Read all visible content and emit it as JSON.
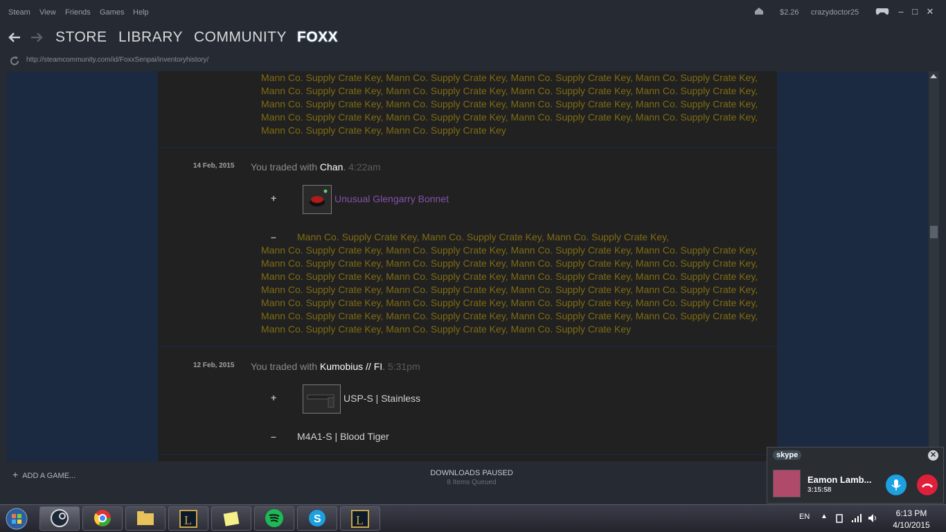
{
  "menu": {
    "items": [
      "Steam",
      "View",
      "Friends",
      "Games",
      "Help"
    ]
  },
  "account": {
    "balance": "$2.26",
    "username": "crazydoctor25"
  },
  "nav": {
    "store": "STORE",
    "library": "LIBRARY",
    "community": "COMMUNITY",
    "profile": "FOXX"
  },
  "url": "http://steamcommunity.com/id/FoxxSenpai/inventoryhistory/",
  "top_block": {
    "lines": [
      "Mann Co. Supply Crate Key, Mann Co. Supply Crate Key, Mann Co. Supply Crate Key, Mann Co. Supply Crate Key,",
      "Mann Co. Supply Crate Key, Mann Co. Supply Crate Key, Mann Co. Supply Crate Key, Mann Co. Supply Crate Key,",
      "Mann Co. Supply Crate Key, Mann Co. Supply Crate Key, Mann Co. Supply Crate Key, Mann Co. Supply Crate Key,",
      "Mann Co. Supply Crate Key, Mann Co. Supply Crate Key, Mann Co. Supply Crate Key, Mann Co. Supply Crate Key,",
      "Mann Co. Supply Crate Key, Mann Co. Supply Crate Key"
    ]
  },
  "trade1": {
    "date": "14 Feb, 2015",
    "prefix": "You traded with ",
    "partner": "Chan",
    "sep": ". ",
    "time": "4:22am",
    "plus": "+",
    "minus": "–",
    "received_item": "Unusual Glengarry Bonnet",
    "given_lines": [
      "Mann Co. Supply Crate Key, Mann Co. Supply Crate Key, Mann Co. Supply Crate Key,",
      "Mann Co. Supply Crate Key, Mann Co. Supply Crate Key, Mann Co. Supply Crate Key, Mann Co. Supply Crate Key,",
      "Mann Co. Supply Crate Key, Mann Co. Supply Crate Key, Mann Co. Supply Crate Key, Mann Co. Supply Crate Key,",
      "Mann Co. Supply Crate Key, Mann Co. Supply Crate Key, Mann Co. Supply Crate Key, Mann Co. Supply Crate Key,",
      "Mann Co. Supply Crate Key, Mann Co. Supply Crate Key, Mann Co. Supply Crate Key, Mann Co. Supply Crate Key,",
      "Mann Co. Supply Crate Key, Mann Co. Supply Crate Key, Mann Co. Supply Crate Key, Mann Co. Supply Crate Key,",
      "Mann Co. Supply Crate Key, Mann Co. Supply Crate Key, Mann Co. Supply Crate Key, Mann Co. Supply Crate Key,",
      "Mann Co. Supply Crate Key, Mann Co. Supply Crate Key, Mann Co. Supply Crate Key"
    ]
  },
  "trade2": {
    "date": "12 Feb, 2015",
    "prefix": "You traded with ",
    "partner": "Kumobius // FI",
    "sep": ". ",
    "time": "5:31pm",
    "plus": "+",
    "minus": "–",
    "received_item": "USP-S | Stainless",
    "given_item": "M4A1-S | Blood Tiger"
  },
  "bottom": {
    "add_game": "ADD A GAME...",
    "downloads": "DOWNLOADS PAUSED",
    "queued": "8 Items Queued"
  },
  "skype": {
    "logo": "skype",
    "caller": "Eamon Lamb...",
    "duration": "3:15:58"
  },
  "taskbar": {
    "lang": "EN",
    "time": "6:13 PM",
    "date": "4/10/2015"
  },
  "colors": {
    "key_item": "#7f6c12",
    "unusual_item": "#8650ac",
    "normal_item": "#d2d2d2",
    "content_bg": "#212121",
    "side_bg": "#1b2a40"
  },
  "icons": [
    "back-arrow-icon",
    "forward-arrow-icon",
    "refresh-icon",
    "notification-icon",
    "controller-icon",
    "scroll-up-icon",
    "plus-icon",
    "mic-icon",
    "hangup-icon",
    "windows-start-icon"
  ]
}
